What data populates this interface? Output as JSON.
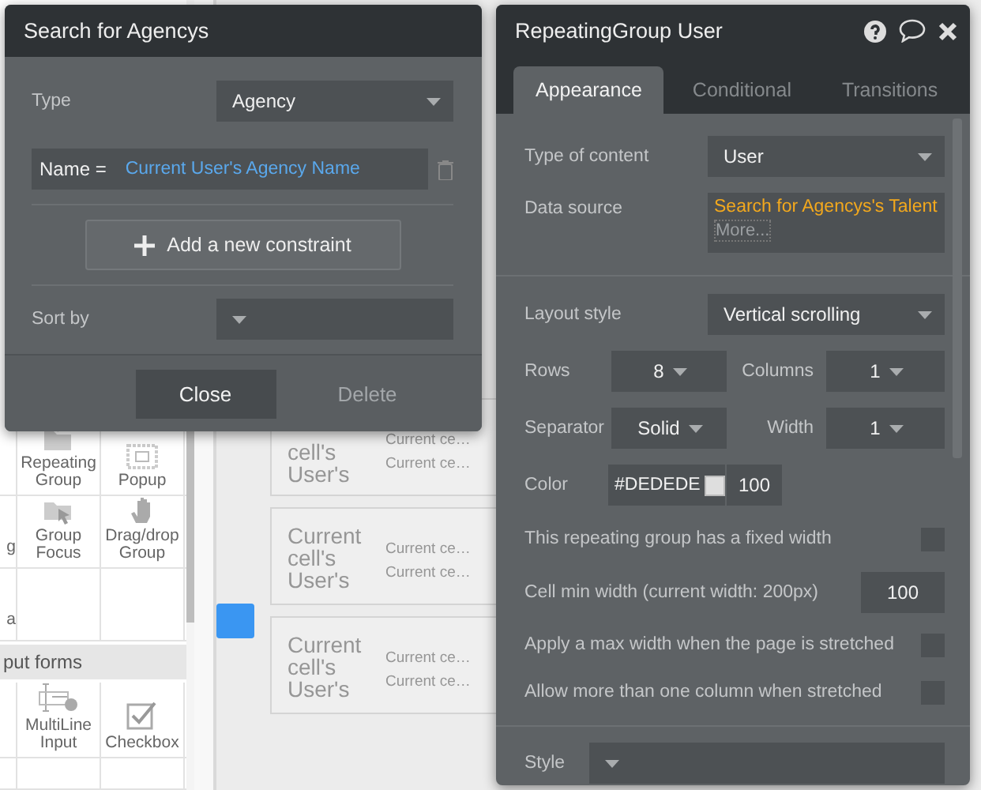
{
  "palette": [
    {
      "kind": "row",
      "items": [
        "Repeating Group",
        "Popup"
      ]
    },
    {
      "kind": "row",
      "side": "g",
      "items": [
        "Group Focus",
        "Drag/drop Group"
      ]
    },
    {
      "kind": "row",
      "side": "a"
    },
    {
      "kind": "section",
      "label": "put forms"
    },
    {
      "kind": "row",
      "items": [
        "MultiLine Input",
        "Checkbox"
      ]
    },
    {
      "kind": "row"
    }
  ],
  "canvas": {
    "cards": [
      {
        "title": "cell's User's",
        "lines": [
          "Current ce…",
          "Current ce…"
        ]
      },
      {
        "title": "Current cell's User's",
        "lines": [
          "Current ce…",
          "Current ce…"
        ]
      },
      {
        "title": "Current cell's User's",
        "lines": [
          "Current ce…",
          "Current ce…"
        ]
      }
    ]
  },
  "search_dialog": {
    "title": "Search for Agencys",
    "type_label": "Type",
    "type_value": "Agency",
    "constraint": {
      "field": "Name =",
      "value": "Current User's Agency Name"
    },
    "add_button": "Add a new constraint",
    "sort_label": "Sort by",
    "buttons": [
      {
        "label": "Close",
        "disabled": false
      },
      {
        "label": "Delete",
        "disabled": true
      }
    ]
  },
  "property_panel": {
    "title": "RepeatingGroup User",
    "tabs": [
      {
        "label": "Appearance",
        "selected": true
      },
      {
        "label": "Conditional",
        "selected": false
      },
      {
        "label": "Transitions",
        "selected": false
      }
    ],
    "sections": [
      {
        "rows": [
          {
            "kind": "dropdown",
            "label": "Type of content",
            "value": "User"
          },
          {
            "kind": "source",
            "label": "Data source",
            "value": "Search for Agencys's Talent",
            "more": "More..."
          }
        ]
      },
      {
        "rows": [
          {
            "kind": "dropdown",
            "label": "Layout style",
            "value": "Vertical scrolling"
          },
          {
            "kind": "pair",
            "label": "Rows",
            "value": "8",
            "label2": "Columns",
            "value2": "1"
          },
          {
            "kind": "pair",
            "label": "Separator",
            "value": "Solid",
            "label2": "Width",
            "value2": "1"
          },
          {
            "kind": "color",
            "label": "Color",
            "value": "#DEDEDE",
            "opacity": "100"
          },
          {
            "kind": "check",
            "label": "This repeating group has a fixed width",
            "checked": false
          },
          {
            "kind": "number",
            "label": "Cell min width (current width: 200px)",
            "value": "100"
          },
          {
            "kind": "check",
            "label": "Apply a max width when the page is stretched",
            "checked": false
          },
          {
            "kind": "check",
            "label": "Allow more than one column when stretched",
            "checked": false
          }
        ]
      },
      {
        "rows": [
          {
            "kind": "wide",
            "label": "Style"
          }
        ]
      }
    ]
  }
}
